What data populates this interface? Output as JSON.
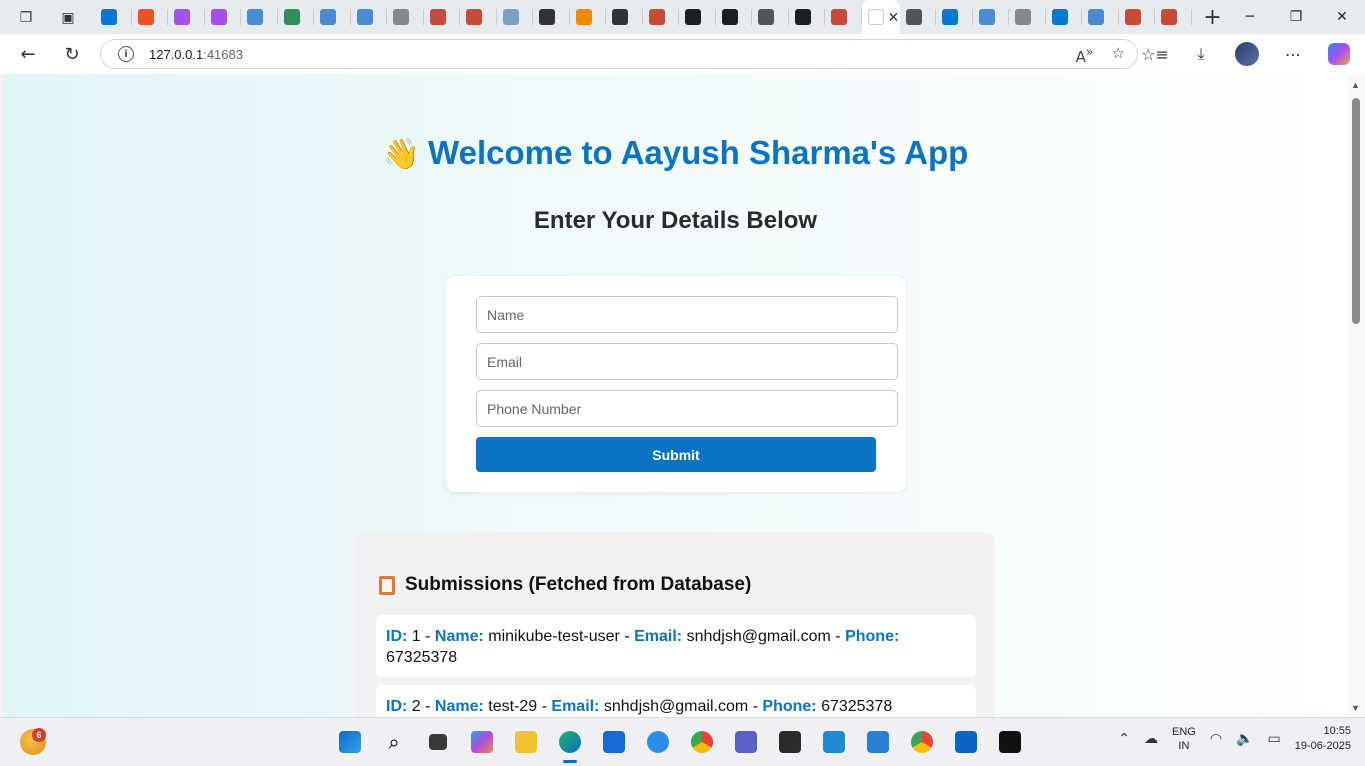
{
  "browser": {
    "address": {
      "host": "127.0.0.1",
      "port": ":41683"
    },
    "tab_favicon_colors": [
      "#0078d4",
      "#f25022",
      "#a64ff0",
      "#a64ff0",
      "#4a8bd6",
      "#2f8f5a",
      "#4a8bd6",
      "#4a8bd6",
      "#888888",
      "#c84b3a",
      "#c84b3a",
      "#7aa0c8",
      "#333333",
      "#f08a00",
      "#333333",
      "#c84b3a",
      "#1b1f23",
      "#1b1f23",
      "#555555",
      "#1b1f23",
      "#c84b3a",
      "#ffffff",
      "#555555",
      "#0078d4",
      "#4a8bd6",
      "#888888",
      "#0078d4",
      "#4a8bd6",
      "#c84b3a",
      "#c84b3a"
    ]
  },
  "page": {
    "headline": "Welcome to Aayush Sharma's App",
    "subheading": "Enter Your Details Below",
    "form": {
      "name_placeholder": "Name",
      "email_placeholder": "Email",
      "phone_placeholder": "Phone Number",
      "submit_label": "Submit"
    },
    "submissions": {
      "title": "Submissions (Fetched from Database)",
      "id_key": "ID:",
      "name_key": "Name:",
      "email_key": "Email:",
      "phone_key": "Phone:",
      "items": [
        {
          "id": "1",
          "name": "minikube-test-user",
          "email": "snhdjsh@gmail.com",
          "phone": "67325378"
        },
        {
          "id": "2",
          "name": "test-29",
          "email": "snhdjsh@gmail.com",
          "phone": "67325378"
        }
      ]
    }
  },
  "taskbar": {
    "weather_badge": "6",
    "lang_line1": "ENG",
    "lang_line2": "IN",
    "time": "10:55",
    "date": "19-06-2025"
  },
  "colors": {
    "accent": "#0a73c4",
    "button": "#0a73c4"
  }
}
